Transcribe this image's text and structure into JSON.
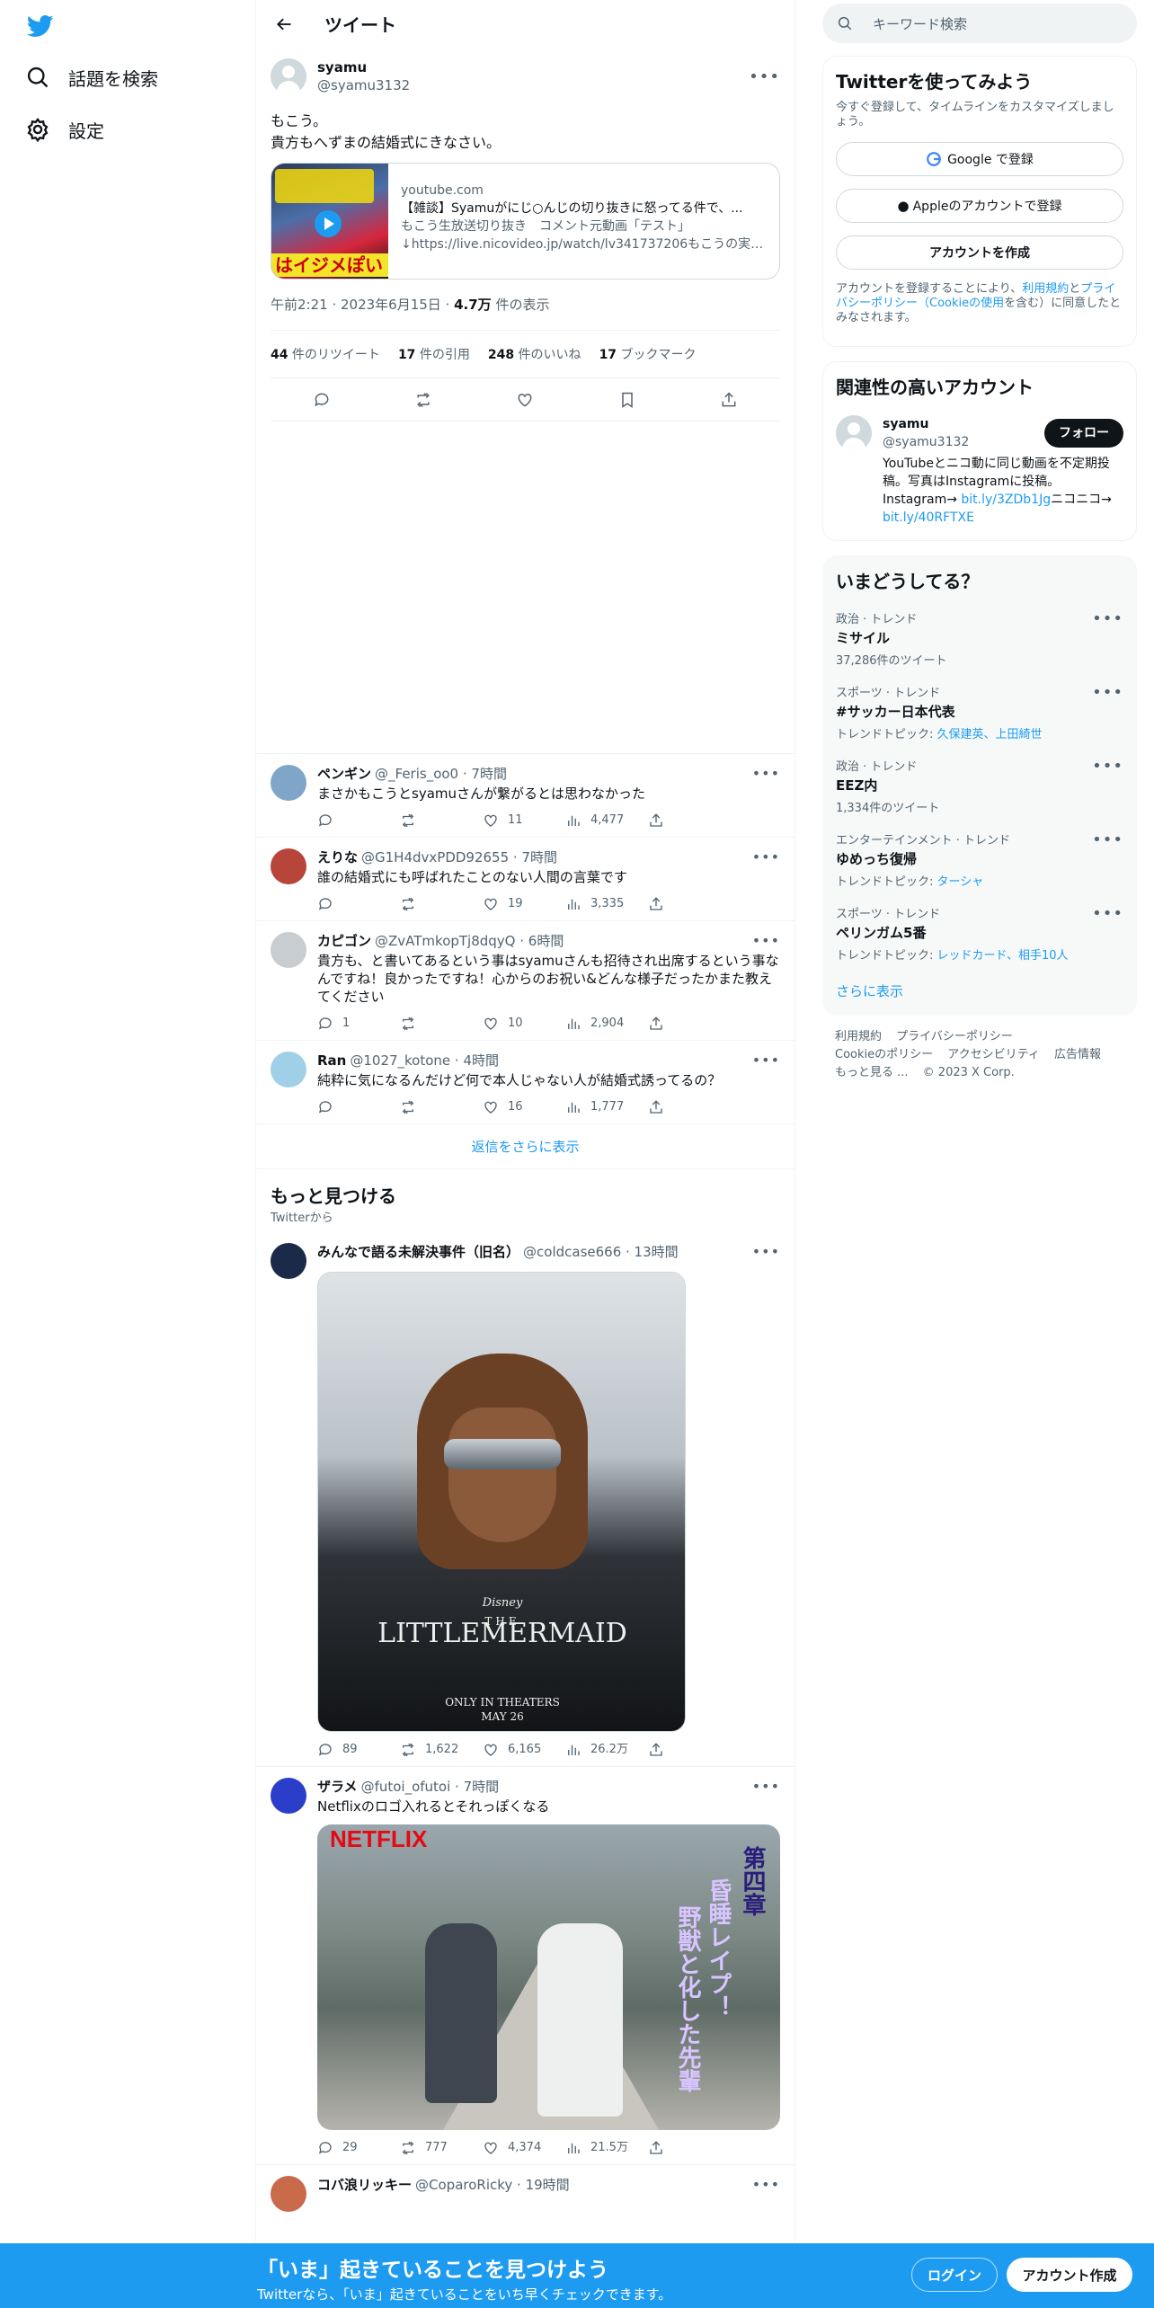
{
  "nav": {
    "explore_label": "話題を検索",
    "settings_label": "設定"
  },
  "header": {
    "title": "ツイート"
  },
  "focus_tweet": {
    "name": "syamu",
    "handle": "@syamu3132",
    "text": "もこう。\n貴方もへずまの結婚式にきなさい。",
    "card": {
      "domain": "youtube.com",
      "title": "【雑談】Syamuがにじ○んじの切り抜きに怒ってる件で、...",
      "desc1": "もこう生放送切り抜き　コメント元動画「テスト」",
      "desc2": "↓https://live.nicovideo.jp/watch/lv341737206もこうの実況...",
      "thumb_text": "はイジメぽい"
    },
    "time": "午前2:21 · 2023年6月15日 · ",
    "views": "4.7万",
    "views_suffix": " 件の表示",
    "stats": {
      "retweets": "44",
      "retweets_label": " 件のリツイート",
      "quotes": "17",
      "quotes_label": " 件の引用",
      "likes": "248",
      "likes_label": " 件のいいね",
      "bookmarks": "17",
      "bookmarks_label": " ブックマーク"
    }
  },
  "replies": [
    {
      "name": "ペンギン",
      "handle": "@_Feris_oo0 · 7時間",
      "text": "まさかもこうとsyamuさんが繋がるとは思わなかった",
      "replies": "",
      "retweets": "",
      "likes": "11",
      "views": "4,477",
      "avatar_color": "#7fa6c9"
    },
    {
      "name": "えりな",
      "handle": "@G1H4dvxPDD92655 · 7時間",
      "text": "誰の結婚式にも呼ばれたことのない人間の言葉です",
      "replies": "",
      "retweets": "",
      "likes": "19",
      "views": "3,335",
      "avatar_color": "#b8453a"
    },
    {
      "name": "カピゴン",
      "handle": "@ZvATmkopTj8dqyQ · 6時間",
      "text": "貴方も、と書いてあるという事はsyamuさんも招待され出席するという事なんですね！良かったですね！心からのお祝い&どんな様子だったかまた教えてください",
      "replies": "1",
      "retweets": "",
      "likes": "10",
      "views": "2,904",
      "avatar_color": "#c7cdd1"
    },
    {
      "name": "Ran",
      "handle": "@1027_kotone · 4時間",
      "text": "純粋に気になるんだけど何で本人じゃない人が結婚式誘ってるの？",
      "replies": "",
      "retweets": "",
      "likes": "16",
      "views": "1,777",
      "avatar_color": "#9fd0e8"
    }
  ],
  "show_more_replies": "返信をさらに表示",
  "discover": {
    "title": "もっと見つける",
    "sub": "Twitterから",
    "tweets": [
      {
        "name": "みんなで語る未解決事件（旧名）",
        "handle": "@coldcase666 · 13時間",
        "text": "",
        "replies": "89",
        "retweets": "1,622",
        "likes": "6,165",
        "views": "26.2万",
        "media_brand": "Disney",
        "media_the": "THE",
        "media_title": "LITTLEMERMAID",
        "media_sub1": "ONLY IN THEATERS",
        "media_sub2": "MAY 26"
      },
      {
        "name": "ザラメ",
        "handle": "@futoi_ofutoi · 7時間",
        "text": "Netflixのロゴ入れるとそれっぽくなる",
        "replies": "29",
        "retweets": "777",
        "likes": "4,374",
        "views": "21.5万",
        "media_logo": "NETFLIX",
        "media_v1": "第四章",
        "media_v2": "昏睡レイプ！",
        "media_v3": "野獣と化した先輩"
      },
      {
        "name": "コバ浪リッキー",
        "handle": "@CoparoRicky · 19時間",
        "text": ""
      }
    ]
  },
  "search": {
    "placeholder": "キーワード検索"
  },
  "signup_panel": {
    "title": "Twitterを使ってみよう",
    "desc": "今すぐ登録して、タイムラインをカスタマイズしましょう。",
    "google": "Google で登録",
    "apple": "Appleのアカウントで登録",
    "create": "アカウントを作成",
    "legal_1": "アカウントを登録することにより、",
    "legal_terms": "利用規約",
    "legal_2": "と",
    "legal_privacy": "プライバシーポリシー（Cookieの使用",
    "legal_3": "を含む）に同意したとみなされます。"
  },
  "related": {
    "title": "関連性の高いアカウント",
    "name": "syamu",
    "handle": "@syamu3132",
    "follow": "フォロー",
    "bio1": "YouTubeとニコ動に同じ動画を不定期投稿。写真はInstagramに投稿。Instagram→ ",
    "link1": "bit.ly/3ZDb1Jg",
    "bio2": "ニコニコ→ ",
    "link2": "bit.ly/40RFTXE"
  },
  "trends": {
    "title": "いまどうしてる？",
    "items": [
      {
        "cat": "政治 · トレンド",
        "title": "ミサイル",
        "sub": "37,286件のツイート",
        "topics": ""
      },
      {
        "cat": "スポーツ · トレンド",
        "title": "#サッカー日本代表",
        "sub": "トレンドトピック: ",
        "topics": "久保建英、上田綺世"
      },
      {
        "cat": "政治 · トレンド",
        "title": "EEZ内",
        "sub": "1,334件のツイート",
        "topics": ""
      },
      {
        "cat": "エンターテインメント · トレンド",
        "title": "ゆめっち復帰",
        "sub": "トレンドトピック: ",
        "topics": "ターシャ"
      },
      {
        "cat": "スポーツ · トレンド",
        "title": "ペリンガム5番",
        "sub": "トレンドトピック: ",
        "topics": "レッドカード、相手10人"
      }
    ],
    "show_more": "さらに表示"
  },
  "footer": {
    "terms": "利用規約",
    "privacy": "プライバシーポリシー",
    "cookie": "Cookieのポリシー",
    "access": "アクセシビリティ",
    "ads": "広告情報",
    "more": "もっと見る ...",
    "copy": "© 2023 X Corp."
  },
  "banner": {
    "title": "「いま」起きていることを見つけよう",
    "sub": "Twitterなら、「いま」起きていることをいち早くチェックできます。",
    "login": "ログイン",
    "signup": "アカウント作成"
  },
  "colors": {
    "accent": "#1d9bf0",
    "text": "#0f1419",
    "secondary": "#536471",
    "border": "#eff3f4"
  }
}
